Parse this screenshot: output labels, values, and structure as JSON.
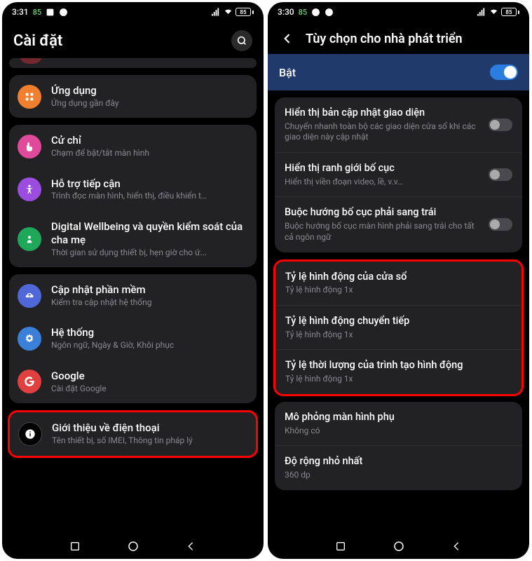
{
  "left": {
    "status": {
      "time": "3:31",
      "count": "85",
      "battery": "85"
    },
    "title": "Cài đặt",
    "partial_top": "",
    "items": {
      "apps": {
        "title": "Ứng dụng",
        "sub": "Ứng dụng gần đây"
      },
      "gesture": {
        "title": "Cử chỉ",
        "sub": "Chạm để bật/tắt màn hình"
      },
      "accessibility": {
        "title": "Hỗ trợ tiếp cận",
        "sub": "Trình đọc màn hình, hiển thị, điều khiển t…"
      },
      "wellbeing": {
        "title": "Digital Wellbeing và quyền kiểm soát của cha mẹ",
        "sub": "Thời gian sử dụng thiết bị, hẹn giờ cho ứ..."
      },
      "update": {
        "title": "Cập nhật phần mềm",
        "sub": "Kiểm tra cập nhật hệ thống"
      },
      "system": {
        "title": "Hệ thống",
        "sub": "Ngôn ngữ, Ngày & Giờ, Khôi phục"
      },
      "google": {
        "title": "Google",
        "sub": "Cài đặt Google"
      },
      "about": {
        "title": "Giới thiệu về điện thoại",
        "sub": "Tên thiết bị, số IMEI, Thông tin pháp lý"
      }
    }
  },
  "right": {
    "status": {
      "time": "3:30",
      "count": "85",
      "battery": "85"
    },
    "title": "Tùy chọn cho nhà phát triển",
    "enable_label": "Bật",
    "items": {
      "update_ui": {
        "title": "Hiển thị bản cập nhật giao diện",
        "sub": "Chuyển nhanh toàn bộ các giao diện cửa sổ khi các giao diện này cập nhật"
      },
      "layout_bounds": {
        "title": "Hiển thị ranh giới bố cục",
        "sub": "Hiển thị viền đoạn video, lề, v.v…"
      },
      "force_rtl": {
        "title": "Buộc hướng bố cục phải sang trái",
        "sub": "Buộc hướng bố cục màn hình phải sang trái cho tất cả ngôn ngữ"
      },
      "window_anim": {
        "title": "Tỷ lệ hình động của cửa sổ",
        "sub": "Tỷ lệ hình động 1x"
      },
      "trans_anim": {
        "title": "Tỷ lệ hình động chuyển tiếp",
        "sub": "Tỷ lệ hình động 1x"
      },
      "animator": {
        "title": "Tỷ lệ thời lượng của trình tạo hình động",
        "sub": "Tỷ lệ hình động 1x"
      },
      "secondary": {
        "title": "Mô phỏng màn hình phụ",
        "sub": "Không có"
      },
      "min_width": {
        "title": "Độ rộng nhỏ nhất",
        "sub": "360 dp"
      }
    }
  }
}
